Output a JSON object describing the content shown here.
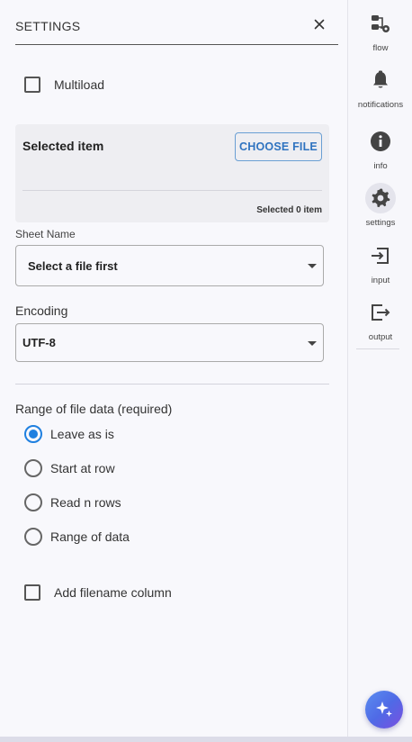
{
  "header": {
    "title": "SETTINGS"
  },
  "multiload": {
    "label": "Multiload",
    "checked": false
  },
  "selected_item": {
    "title": "Selected item",
    "choose_button": "CHOOSE FILE",
    "count_text": "Selected 0 item"
  },
  "sheet_name": {
    "label": "Sheet Name",
    "value": "Select a file first"
  },
  "encoding": {
    "label": "Encoding",
    "value": "UTF-8"
  },
  "range": {
    "label": "Range of file data (required)",
    "options": [
      {
        "label": "Leave as is",
        "checked": true
      },
      {
        "label": "Start at row",
        "checked": false
      },
      {
        "label": "Read n rows",
        "checked": false
      },
      {
        "label": "Range of data",
        "checked": false
      }
    ]
  },
  "add_filename": {
    "label": "Add filename column",
    "checked": false
  },
  "rail": {
    "items": [
      {
        "label": "flow",
        "icon": "flow-icon"
      },
      {
        "label": "notifications",
        "icon": "bell-icon"
      },
      {
        "label": "info",
        "icon": "info-icon"
      },
      {
        "label": "settings",
        "icon": "gear-icon",
        "active": true
      },
      {
        "label": "input",
        "icon": "input-icon"
      },
      {
        "label": "output",
        "icon": "output-icon"
      }
    ]
  },
  "colors": {
    "accent": "#1f80e0",
    "button_text": "#2f73c0"
  }
}
